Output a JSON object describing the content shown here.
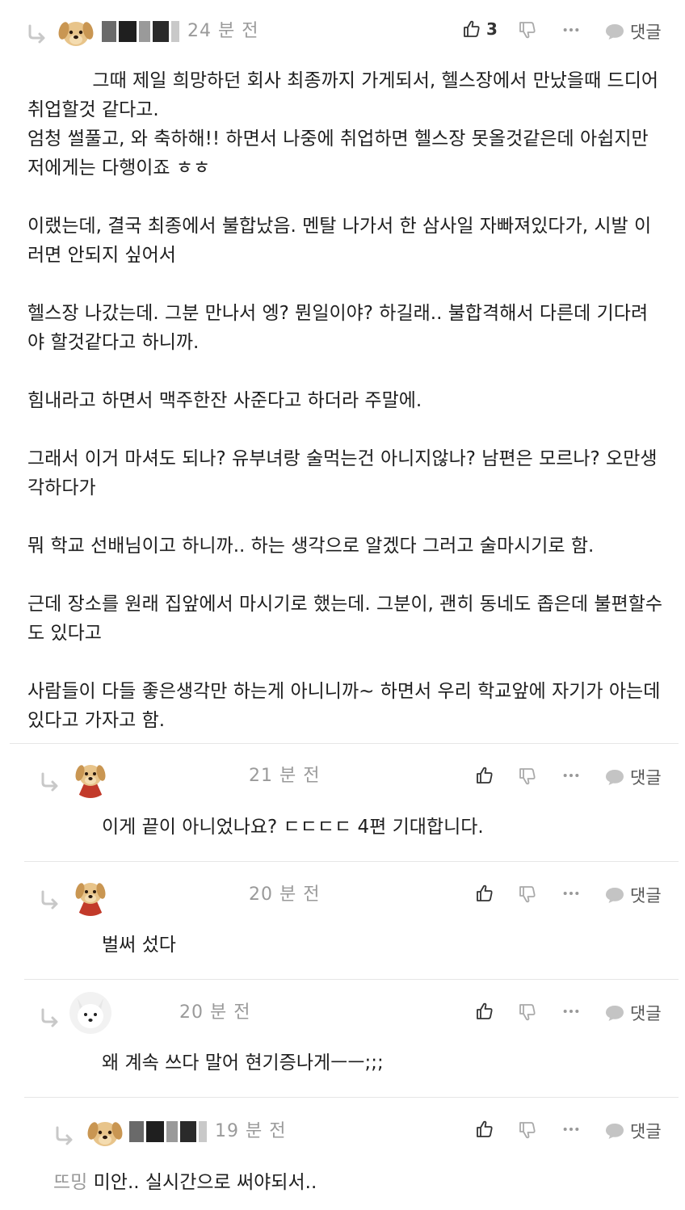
{
  "comments": [
    {
      "time": "24 분 전",
      "likes": "3",
      "reply_label": "댓글",
      "more": "···",
      "avatar": "puppy",
      "text": "           그때 제일 희망하던 회사 최종까지 가게되서, 헬스장에서 만났을때 드디어 취업할것 같다고.\n엄청 썰풀고, 와 축하해!! 하면서 나중에 취업하면 헬스장 못올것같은데 아쉽지만 저에게는 다행이죠 ㅎㅎ\n\n이랬는데, 결국 최종에서 불합났음. 멘탈 나가서 한 삼사일 자빠져있다가, 시발 이러면 안되지 싶어서\n\n헬스장 나갔는데. 그분 만나서 엥? 뭔일이야? 하길래.. 불합격해서 다른데 기다려야 할것같다고 하니까.\n\n힘내라고 하면서 맥주한잔 사준다고 하더라 주말에.\n\n그래서 이거 마셔도 되나? 유부녀랑 술먹는건 아니지않나? 남편은 모르나? 오만생각하다가\n\n뭐 학교 선배님이고 하니까.. 하는 생각으로 알겠다 그러고 술마시기로 함.\n\n근데 장소를 원래 집앞에서 마시기로 했는데. 그분이, 괜히 동네도 좁은데 불편할수도 있다고\n\n사람들이 다들 좋은생각만 하는게 아니니까~ 하면서 우리 학교앞에 자기가 아는데 있다고 가자고 함."
    },
    {
      "time": "21 분 전",
      "reply_label": "댓글",
      "more": "···",
      "avatar": "puppy-red-cape",
      "text": "이게 끝이 아니었나요? ㄷㄷㄷㄷ 4편 기대합니다."
    },
    {
      "time": "20 분 전",
      "reply_label": "댓글",
      "more": "···",
      "avatar": "puppy-red-cape",
      "text": "벌써 섰다"
    },
    {
      "time": "20 분 전",
      "reply_label": "댓글",
      "more": "···",
      "avatar": "white-fox",
      "text": "왜 계속 쓰다 말어 현기증나게ㅡㅡ;;;"
    },
    {
      "time": "19 분 전",
      "reply_label": "댓글",
      "more": "···",
      "avatar": "puppy",
      "mention": "뜨밍",
      "text": " 미안.. 실시간으로 써야되서.."
    }
  ],
  "icons": {
    "reply": "reply-arrow-icon",
    "like": "thumbs-up-icon",
    "dislike": "thumbs-down-icon",
    "more": "more-dots-icon",
    "comment": "speech-bubble-icon"
  }
}
